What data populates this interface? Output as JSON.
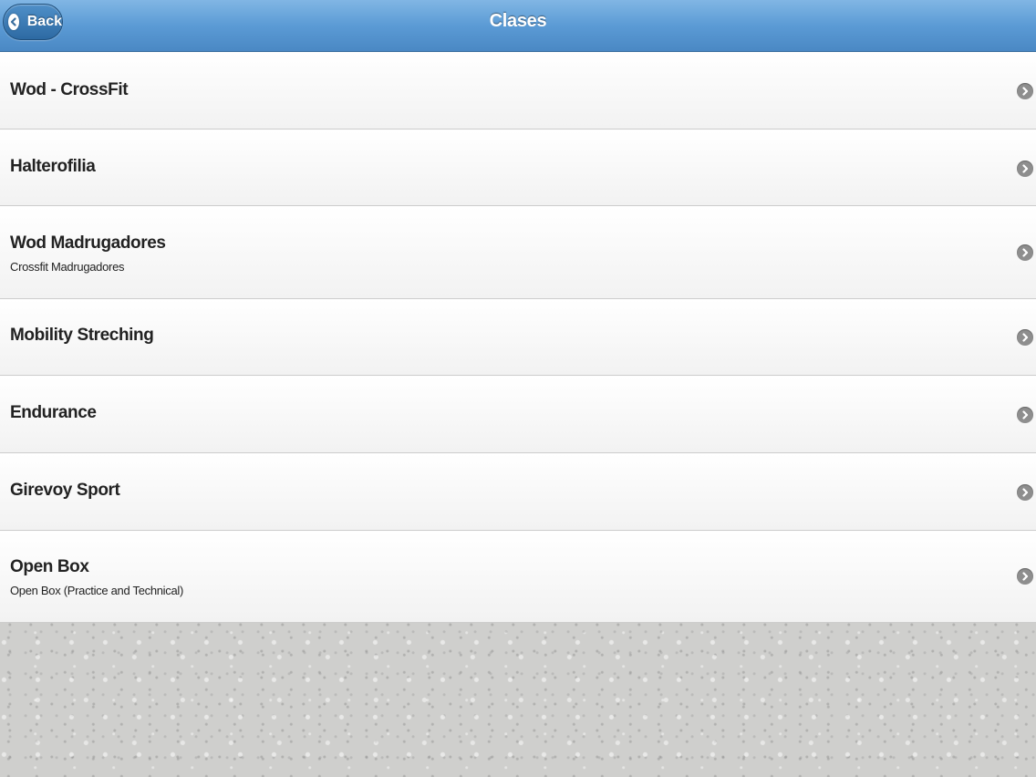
{
  "header": {
    "title": "Clases",
    "back_label": "Back"
  },
  "classes": [
    {
      "title": "Wod - CrossFit",
      "subtitle": ""
    },
    {
      "title": "Halterofilia",
      "subtitle": ""
    },
    {
      "title": "Wod Madrugadores",
      "subtitle": "Crossfit Madrugadores"
    },
    {
      "title": "Mobility Streching",
      "subtitle": ""
    },
    {
      "title": "Endurance",
      "subtitle": ""
    },
    {
      "title": "Girevoy Sport",
      "subtitle": ""
    },
    {
      "title": "Open Box",
      "subtitle": "Open Box (Practice and Technical)"
    }
  ],
  "colors": {
    "header_gradient_top": "#81b6e4",
    "header_gradient_bottom": "#4a88c4",
    "chevron": "#8e8e8e",
    "text": "#222222"
  },
  "icons": {
    "back": "chevron-left-icon",
    "row": "chevron-right-icon"
  }
}
